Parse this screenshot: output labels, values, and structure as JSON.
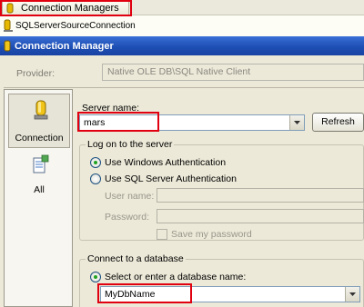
{
  "connection_managers": {
    "tab_label": "Connection Managers",
    "items": [
      {
        "label": "SQLServerSourceConnection"
      }
    ]
  },
  "dialog": {
    "title": "Connection Manager",
    "provider_label": "Provider:",
    "provider_value": "Native OLE DB\\SQL Native Client",
    "nav": [
      {
        "label": "Connection",
        "icon": "connection-icon",
        "selected": true
      },
      {
        "label": "All",
        "icon": "all-properties-icon",
        "selected": false
      }
    ],
    "server_name_label": "Server name:",
    "server_name_value": "mars",
    "refresh_label": "Refresh",
    "logon_group_title": "Log on to the server",
    "windows_auth_label": "Use Windows Authentication",
    "sql_auth_label": "Use SQL Server Authentication",
    "username_label": "User name:",
    "password_label": "Password:",
    "save_password_label": "Save my password",
    "connect_group_title": "Connect to a database",
    "select_db_label": "Select or enter a database name:",
    "database_value": "MyDbName"
  },
  "colors": {
    "highlight": "#e0000f",
    "titlebar": "#1e4fb4",
    "dialog_bg": "#ece9d8"
  }
}
